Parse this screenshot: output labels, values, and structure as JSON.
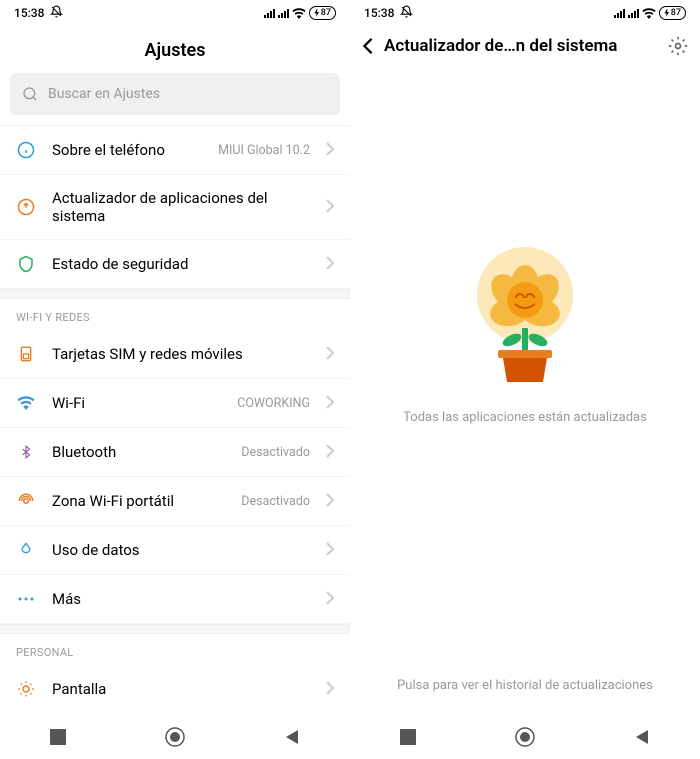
{
  "status": {
    "time": "15:38",
    "battery": "87"
  },
  "left": {
    "title": "Ajustes",
    "searchPlaceholder": "Buscar en Ajustes",
    "items": [
      {
        "label": "Sobre el teléfono",
        "value": "MIUI Global 10.2"
      },
      {
        "label": "Actualizador de aplicaciones del sistema",
        "value": ""
      },
      {
        "label": "Estado de seguridad",
        "value": ""
      }
    ],
    "sectionNetwork": "WI-FI Y REDES",
    "networkItems": [
      {
        "label": "Tarjetas SIM y redes móviles",
        "value": ""
      },
      {
        "label": "Wi-Fi",
        "value": "COWORKING"
      },
      {
        "label": "Bluetooth",
        "value": "Desactivado"
      },
      {
        "label": "Zona Wi-Fi portátil",
        "value": "Desactivado"
      },
      {
        "label": "Uso de datos",
        "value": ""
      },
      {
        "label": "Más",
        "value": ""
      }
    ],
    "sectionPersonal": "PERSONAL",
    "personalItems": [
      {
        "label": "Pantalla",
        "value": ""
      }
    ]
  },
  "right": {
    "title": "Actualizador de…n del sistema",
    "message": "Todas las aplicaciones están actualizadas",
    "footer": "Pulsa para ver el historial de actualizaciones"
  }
}
